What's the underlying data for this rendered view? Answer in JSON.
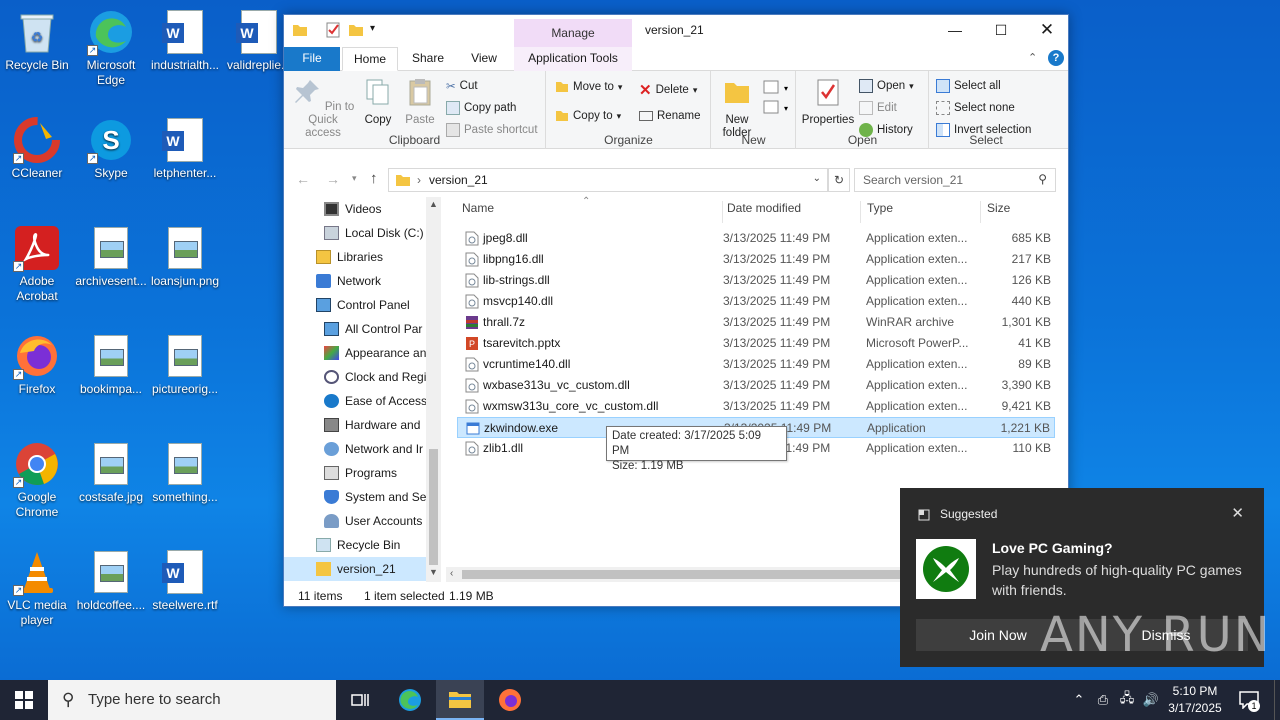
{
  "desktop": {
    "icons": [
      {
        "label": "Recycle Bin"
      },
      {
        "label": "Microsoft Edge"
      },
      {
        "label": "industrialth..."
      },
      {
        "label": "validreplie..."
      },
      {
        "label": "CCleaner"
      },
      {
        "label": "Skype"
      },
      {
        "label": "letphenter..."
      },
      {
        "label": "Adobe Acrobat"
      },
      {
        "label": "archivesent..."
      },
      {
        "label": "loansjun.png"
      },
      {
        "label": "Firefox"
      },
      {
        "label": "bookimpa..."
      },
      {
        "label": "pictureorig..."
      },
      {
        "label": "Google Chrome"
      },
      {
        "label": "costsafe.jpg"
      },
      {
        "label": "something..."
      },
      {
        "label": "VLC media player"
      },
      {
        "label": "holdcoffee...."
      },
      {
        "label": "steelwere.rtf"
      }
    ]
  },
  "explorer": {
    "title": "version_21",
    "manage_label": "Manage",
    "tabs": {
      "file": "File",
      "home": "Home",
      "share": "Share",
      "view": "View",
      "app_tools": "Application Tools"
    },
    "ribbon": {
      "clipboard": {
        "pin": "Pin to Quick access",
        "copy": "Copy",
        "paste": "Paste",
        "cut": "Cut",
        "copy_path": "Copy path",
        "paste_shortcut": "Paste shortcut",
        "label": "Clipboard"
      },
      "organize": {
        "move_to": "Move to",
        "copy_to": "Copy to",
        "delete": "Delete",
        "rename": "Rename",
        "label": "Organize"
      },
      "new": {
        "new_folder": "New folder",
        "label": "New"
      },
      "open": {
        "properties": "Properties",
        "open": "Open",
        "edit": "Edit",
        "history": "History",
        "label": "Open"
      },
      "select": {
        "select_all": "Select all",
        "select_none": "Select none",
        "invert": "Invert selection",
        "label": "Select"
      }
    },
    "address": {
      "path": "version_21",
      "search_placeholder": "Search version_21"
    },
    "nav": [
      {
        "label": "Videos"
      },
      {
        "label": "Local Disk (C:)"
      },
      {
        "label": "Libraries"
      },
      {
        "label": "Network"
      },
      {
        "label": "Control Panel"
      },
      {
        "label": "All Control Par"
      },
      {
        "label": "Appearance an"
      },
      {
        "label": "Clock and Regi"
      },
      {
        "label": "Ease of Access"
      },
      {
        "label": "Hardware and"
      },
      {
        "label": "Network and Ir"
      },
      {
        "label": "Programs"
      },
      {
        "label": "System and Sec"
      },
      {
        "label": "User Accounts"
      },
      {
        "label": "Recycle Bin"
      },
      {
        "label": "version_21"
      }
    ],
    "columns": {
      "name": "Name",
      "date": "Date modified",
      "type": "Type",
      "size": "Size"
    },
    "files": [
      {
        "name": "jpeg8.dll",
        "date": "3/13/2025 11:49 PM",
        "type": "Application exten...",
        "size": "685 KB",
        "kind": "dll"
      },
      {
        "name": "libpng16.dll",
        "date": "3/13/2025 11:49 PM",
        "type": "Application exten...",
        "size": "217 KB",
        "kind": "dll"
      },
      {
        "name": "lib-strings.dll",
        "date": "3/13/2025 11:49 PM",
        "type": "Application exten...",
        "size": "126 KB",
        "kind": "dll"
      },
      {
        "name": "msvcp140.dll",
        "date": "3/13/2025 11:49 PM",
        "type": "Application exten...",
        "size": "440 KB",
        "kind": "dll"
      },
      {
        "name": "thrall.7z",
        "date": "3/13/2025 11:49 PM",
        "type": "WinRAR archive",
        "size": "1,301 KB",
        "kind": "7z"
      },
      {
        "name": "tsarevitch.pptx",
        "date": "3/13/2025 11:49 PM",
        "type": "Microsoft PowerP...",
        "size": "41 KB",
        "kind": "pptx"
      },
      {
        "name": "vcruntime140.dll",
        "date": "3/13/2025 11:49 PM",
        "type": "Application exten...",
        "size": "89 KB",
        "kind": "dll"
      },
      {
        "name": "wxbase313u_vc_custom.dll",
        "date": "3/13/2025 11:49 PM",
        "type": "Application exten...",
        "size": "3,390 KB",
        "kind": "dll"
      },
      {
        "name": "wxmsw313u_core_vc_custom.dll",
        "date": "3/13/2025 11:49 PM",
        "type": "Application exten...",
        "size": "9,421 KB",
        "kind": "dll"
      },
      {
        "name": "zkwindow.exe",
        "date": "3/13/2025 11:49 PM",
        "type": "Application",
        "size": "1,221 KB",
        "kind": "exe"
      },
      {
        "name": "zlib1.dll",
        "date": "3/13/2025 11:49 PM",
        "type": "Application exten...",
        "size": "110 KB",
        "kind": "dll"
      }
    ],
    "tooltip": {
      "line1": "Date created: 3/17/2025 5:09 PM",
      "line2": "Size: 1.19 MB"
    },
    "status": {
      "count": "11 items",
      "selected": "1 item selected",
      "size": "1.19 MB"
    }
  },
  "toast": {
    "header": "Suggested",
    "title": "Love PC Gaming?",
    "body": "Play hundreds of high-quality PC games with friends.",
    "join": "Join Now",
    "dismiss": "Dismiss"
  },
  "watermark": "ANY RUN",
  "taskbar": {
    "search_placeholder": "Type here to search",
    "time": "5:10 PM",
    "date": "3/17/2025",
    "notif_count": "1"
  }
}
